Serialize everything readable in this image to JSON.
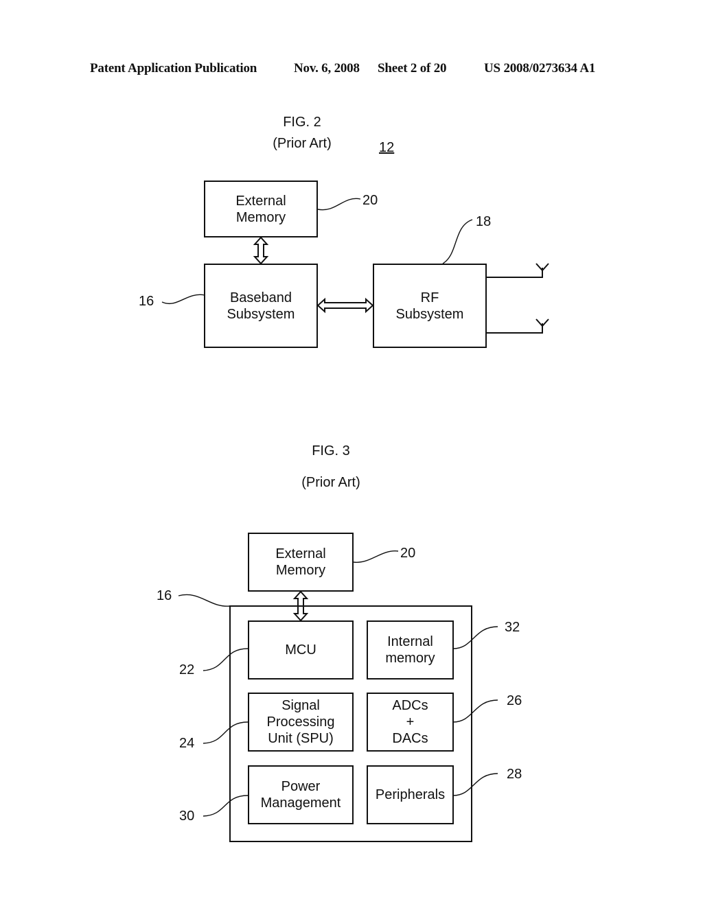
{
  "header": {
    "publication": "Patent Application Publication",
    "date": "Nov. 6, 2008",
    "sheet": "Sheet 2 of 20",
    "number": "US 2008/0273634 A1"
  },
  "fig2": {
    "title": "FIG. 2",
    "subtitle": "(Prior Art)",
    "ref_main": "12",
    "blocks": {
      "external_memory": {
        "line1": "External",
        "line2": "Memory",
        "ref": "20"
      },
      "baseband": {
        "line1": "Baseband",
        "line2": "Subsystem",
        "ref": "16"
      },
      "rf": {
        "line1": "RF",
        "line2": "Subsystem",
        "ref": "18"
      }
    }
  },
  "fig3": {
    "title": "FIG. 3",
    "subtitle": "(Prior Art)",
    "ref_container": "16",
    "blocks": {
      "external_memory": {
        "line1": "External",
        "line2": "Memory",
        "ref": "20"
      },
      "mcu": {
        "line1": "MCU",
        "ref": "22"
      },
      "internal_memory": {
        "line1": "Internal",
        "line2": "memory",
        "ref": "32"
      },
      "spu": {
        "line1": "Signal",
        "line2": "Processing",
        "line3": "Unit (SPU)",
        "ref": "24"
      },
      "adc_dac": {
        "line1": "ADCs",
        "line2": "+",
        "line3": "DACs",
        "ref": "26"
      },
      "power": {
        "line1": "Power",
        "line2": "Management",
        "ref": "30"
      },
      "peripherals": {
        "line1": "Peripherals",
        "ref": "28"
      }
    }
  }
}
